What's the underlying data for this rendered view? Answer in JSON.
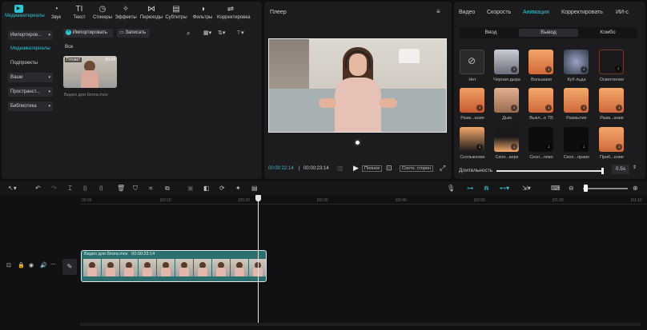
{
  "toolbar": {
    "tabs": [
      {
        "label": "Медиаматериалы",
        "icon": "media-icon",
        "glyph": "▶"
      },
      {
        "label": "Звук",
        "icon": "audio-icon",
        "glyph": "◔"
      },
      {
        "label": "Текст",
        "icon": "text-icon",
        "glyph": "TI"
      },
      {
        "label": "Стикеры",
        "icon": "sticker-icon",
        "glyph": "◷"
      },
      {
        "label": "Эффекты",
        "icon": "effects-icon",
        "glyph": "✧"
      },
      {
        "label": "Переходы",
        "icon": "transitions-icon",
        "glyph": "⋈"
      },
      {
        "label": "Субтитры",
        "icon": "subtitles-icon",
        "glyph": "▤"
      },
      {
        "label": "Фильтры",
        "icon": "filters-icon",
        "glyph": "◑"
      },
      {
        "label": "Корректировка",
        "icon": "adjust-icon",
        "glyph": "⇌"
      }
    ]
  },
  "sidebar": {
    "items": [
      {
        "label": "Импортиров..."
      },
      {
        "label": "Медиаматериалы"
      },
      {
        "label": "Подпроекты"
      },
      {
        "label": "Ваши"
      },
      {
        "label": "Пространст..."
      },
      {
        "label": "Библиотека"
      }
    ]
  },
  "media": {
    "import_label": "Импортировать",
    "record_label": "Записать",
    "section_label": "Все",
    "clip_badge": "Готово!",
    "clip_duration": "00:24",
    "clip_name": "Видео для блога.mov"
  },
  "player": {
    "title": "Плеер",
    "current_time": "00:00:22:14",
    "total_time": "00:00:23:14",
    "full_label": "Полное",
    "ratio_label": "Соотн. сторон"
  },
  "right_panel": {
    "tabs": [
      "Видео",
      "Скорость",
      "Анимация",
      "Корректировать",
      "ИИ-с"
    ],
    "active_tab": "Анимация",
    "subtabs": [
      "Ввод",
      "Вывод",
      "Комбо"
    ],
    "active_subtab": "Вывод",
    "thumbs": [
      "Нет",
      "Черная дыра",
      "Вольшаки",
      "Куб льда",
      "Осветление",
      "Разм...ание",
      "Дым",
      "Выкл...е ТВ",
      "Размытие",
      "Разм...ание",
      "Скольжение",
      "Скол...верх",
      "Скол...лево",
      "Скол...право",
      "Приб...ение"
    ],
    "duration_label": "Длительность",
    "duration_value": "0.5s"
  },
  "timeline": {
    "ticks": [
      "00:00",
      "|00:10",
      "|00:20",
      "|00:30",
      "|00:40",
      "|00:50",
      "|01:00",
      "|01:10"
    ],
    "clip_title": "Видео для блога.mov",
    "clip_duration": "00:00:23:14",
    "playhead_fraction": 0.71
  },
  "colors": {
    "accent": "#2fc6d3",
    "clip": "#2a6e6d"
  }
}
